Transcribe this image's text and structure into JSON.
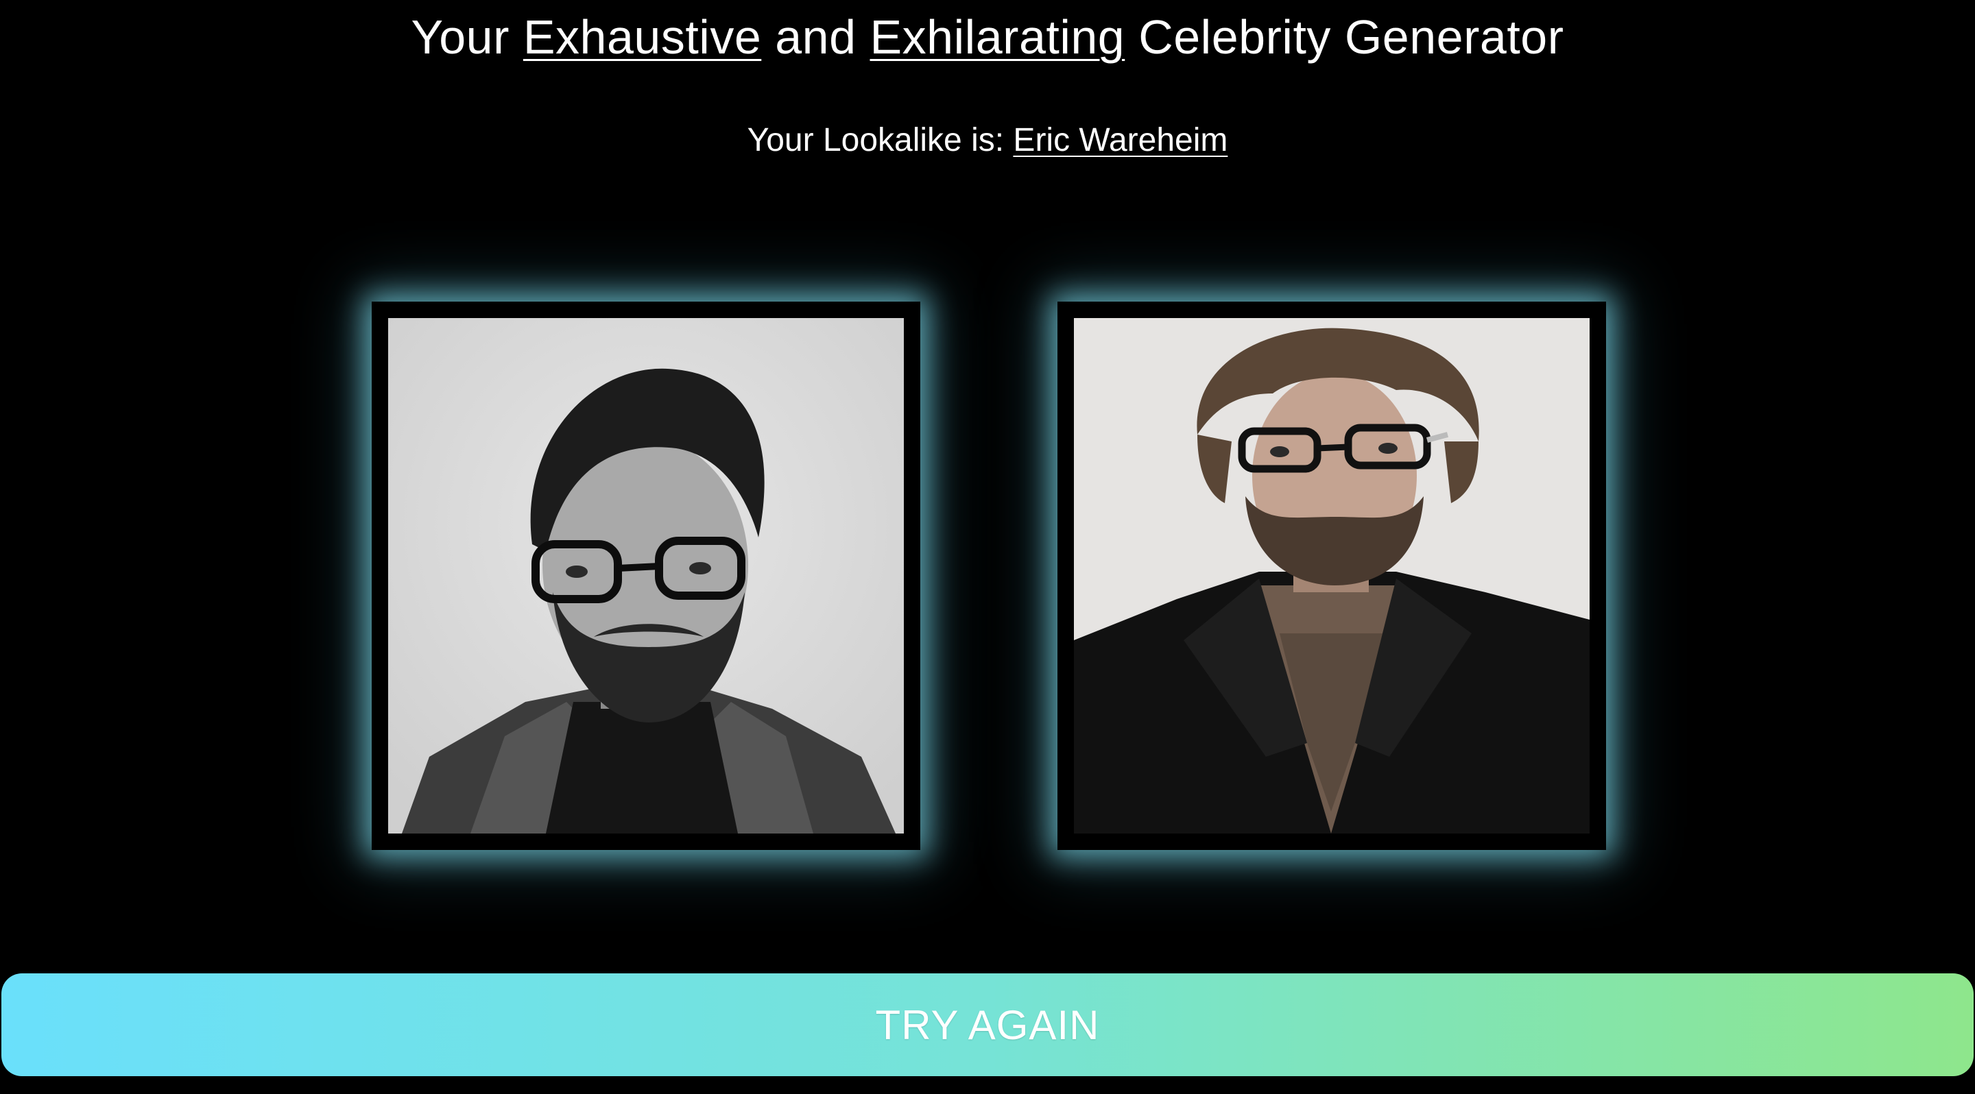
{
  "header": {
    "title_parts": [
      "Your ",
      "Exhaustive",
      " and ",
      "Exhilarating",
      " Celebrity Generator"
    ]
  },
  "result": {
    "label": "Your Lookalike is: ",
    "celebrity_name": "Eric Wareheim"
  },
  "photos": {
    "user_photo": "user-portrait",
    "celebrity_photo": "celebrity-portrait"
  },
  "colors": {
    "glow": "#78d2e1",
    "button_gradient_start": "#6ae0fb",
    "button_gradient_end": "#8ee68c"
  },
  "actions": {
    "try_again_label": "TRY AGAIN"
  }
}
